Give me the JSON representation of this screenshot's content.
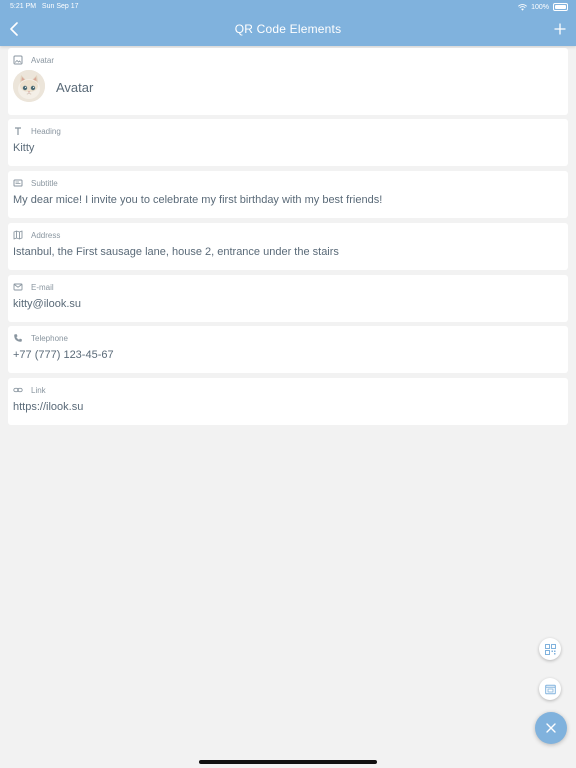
{
  "status_bar": {
    "time": "5:21 PM",
    "date": "Sun Sep 17",
    "battery": "100%"
  },
  "nav": {
    "title": "QR Code Elements",
    "back_icon": "chevron-left-icon",
    "add_icon": "plus-icon"
  },
  "elements": [
    {
      "label": "Avatar",
      "value": "Avatar",
      "icon": "image-icon"
    },
    {
      "label": "Heading",
      "value": "Kitty",
      "icon": "text-icon"
    },
    {
      "label": "Subtitle",
      "value": "My dear mice! I invite you to celebrate my first birthday with my best friends!",
      "icon": "subtitle-icon"
    },
    {
      "label": "Address",
      "value": "Istanbul, the First sausage lane, house 2, entrance under the stairs",
      "icon": "map-icon"
    },
    {
      "label": "E-mail",
      "value": "kitty@ilook.su",
      "icon": "mail-icon"
    },
    {
      "label": "Telephone",
      "value": "+77 (777) 123-45-67",
      "icon": "phone-icon"
    },
    {
      "label": "Link",
      "value": "https://ilook.su",
      "icon": "link-icon"
    }
  ],
  "fabs": {
    "qr_icon": "qr-code-icon",
    "preview_icon": "preview-icon",
    "close_icon": "close-icon"
  },
  "colors": {
    "accent": "#80b2dd",
    "background": "#f2f2f2",
    "card": "#ffffff",
    "text": "#5a6a78",
    "label": "#8a96a0"
  }
}
